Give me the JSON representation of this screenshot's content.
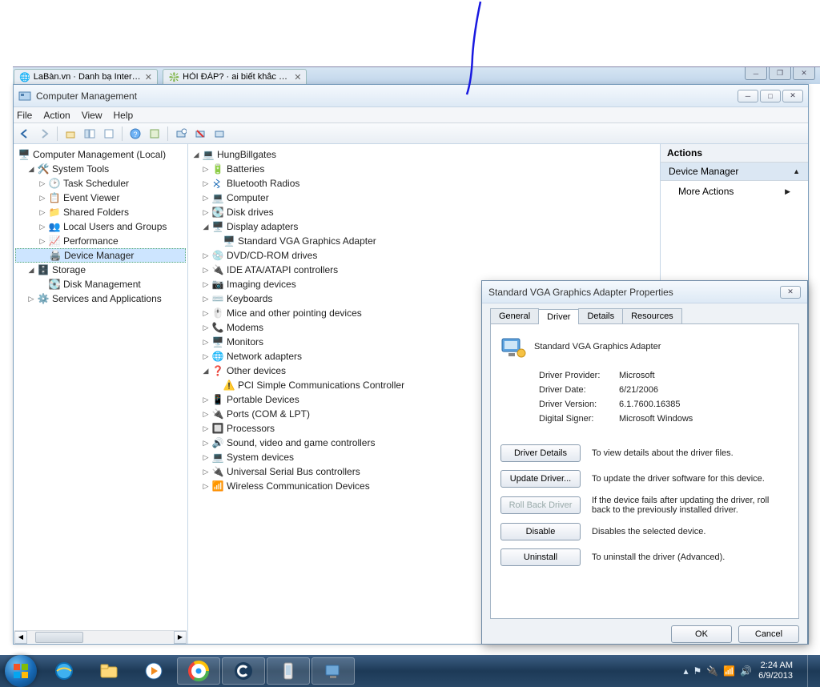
{
  "browser": {
    "tab1": "LaBàn.vn · Danh bạ Intern...",
    "tab2": "HỎI ĐÁP? · ai biết khắc p..."
  },
  "cm": {
    "title": "Computer Management",
    "menu": {
      "file": "File",
      "action": "Action",
      "view": "View",
      "help": "Help"
    }
  },
  "leftTree": {
    "root": "Computer Management (Local)",
    "systemTools": "System Tools",
    "taskScheduler": "Task Scheduler",
    "eventViewer": "Event Viewer",
    "sharedFolders": "Shared Folders",
    "localUsers": "Local Users and Groups",
    "performance": "Performance",
    "deviceManager": "Device Manager",
    "storage": "Storage",
    "diskManagement": "Disk Management",
    "services": "Services and Applications"
  },
  "devTree": {
    "root": "HungBillgates",
    "batteries": "Batteries",
    "bluetooth": "Bluetooth Radios",
    "computer": "Computer",
    "diskDrives": "Disk drives",
    "displayAdapters": "Display adapters",
    "stdVGA": "Standard VGA Graphics Adapter",
    "dvd": "DVD/CD-ROM drives",
    "ide": "IDE ATA/ATAPI controllers",
    "imaging": "Imaging devices",
    "keyboards": "Keyboards",
    "mice": "Mice and other pointing devices",
    "modems": "Modems",
    "monitors": "Monitors",
    "network": "Network adapters",
    "otherDevices": "Other devices",
    "pciSimple": "PCI Simple Communications Controller",
    "portable": "Portable Devices",
    "ports": "Ports (COM & LPT)",
    "processors": "Processors",
    "sound": "Sound, video and game controllers",
    "systemDevices": "System devices",
    "usb": "Universal Serial Bus controllers",
    "wireless": "Wireless Communication Devices"
  },
  "actions": {
    "header": "Actions",
    "deviceManager": "Device Manager",
    "more": "More Actions"
  },
  "prop": {
    "title": "Standard VGA Graphics Adapter Properties",
    "tabs": {
      "general": "General",
      "driver": "Driver",
      "details": "Details",
      "resources": "Resources"
    },
    "deviceName": "Standard VGA Graphics Adapter",
    "provider_k": "Driver Provider:",
    "provider_v": "Microsoft",
    "date_k": "Driver Date:",
    "date_v": "6/21/2006",
    "version_k": "Driver Version:",
    "version_v": "6.1.7600.16385",
    "signer_k": "Digital Signer:",
    "signer_v": "Microsoft Windows",
    "btn_details": "Driver Details",
    "desc_details": "To view details about the driver files.",
    "btn_update": "Update Driver...",
    "desc_update": "To update the driver software for this device.",
    "btn_rollback": "Roll Back Driver",
    "desc_rollback": "If the device fails after updating the driver, roll back to the previously installed driver.",
    "btn_disable": "Disable",
    "desc_disable": "Disables the selected device.",
    "btn_uninstall": "Uninstall",
    "desc_uninstall": "To uninstall the driver (Advanced).",
    "ok": "OK",
    "cancel": "Cancel"
  },
  "tray": {
    "time": "2:24 AM",
    "date": "6/9/2013"
  }
}
